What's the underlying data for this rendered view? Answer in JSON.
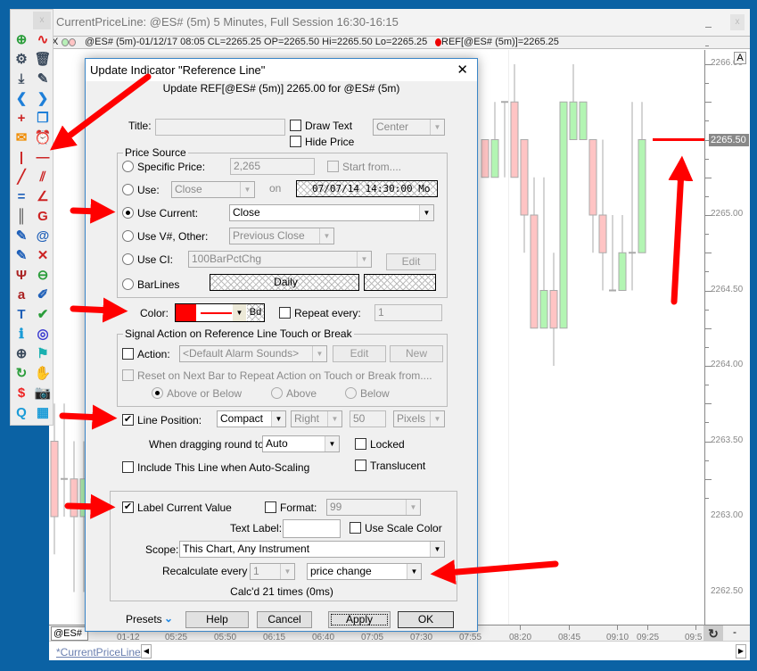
{
  "window": {
    "title": "CurrentPriceLine: @ES# (5m) 5 Minutes, Full Session 16:30-16:15",
    "close_label": "x"
  },
  "infobar": {
    "close": "X",
    "symbol_text": "@ES# (5m)-01/12/17 08:05 CL=2265.25 OP=2265.50 Hi=2265.50 Lo=2265.25",
    "ref_text": "REF[@ES# (5m)]=2265.25"
  },
  "chart": {
    "price_ticks": [
      "2266.00",
      "2265.00",
      "2264.50",
      "2264.00",
      "2263.50",
      "2263.00",
      "2262.50"
    ],
    "current_price_label": "2265.50",
    "reference_line_price": 2265.5,
    "reference_line_color": "#ff0000",
    "up_color": "#b3f5b3",
    "down_color": "#ffc4c4",
    "candles": [
      {
        "o": 2265.5,
        "h": 2265.5,
        "l": 2265.25,
        "c": 2265.25
      },
      {
        "o": 2265.25,
        "h": 2265.75,
        "l": 2265.25,
        "c": 2265.5
      },
      {
        "o": 2265.75,
        "h": 2265.75,
        "l": 2265.25,
        "c": 2265.75
      },
      {
        "o": 2265.75,
        "h": 2266.0,
        "l": 2265.25,
        "c": 2265.25
      },
      {
        "o": 2265.5,
        "h": 2265.5,
        "l": 2264.75,
        "c": 2265.0
      },
      {
        "o": 2265.0,
        "h": 2265.25,
        "l": 2264.25,
        "c": 2264.25
      },
      {
        "o": 2264.25,
        "h": 2265.25,
        "l": 2264.25,
        "c": 2264.5
      },
      {
        "o": 2264.5,
        "h": 2264.75,
        "l": 2264.0,
        "c": 2264.25
      },
      {
        "o": 2264.25,
        "h": 2265.75,
        "l": 2264.25,
        "c": 2265.75
      },
      {
        "o": 2265.5,
        "h": 2266.0,
        "l": 2265.5,
        "c": 2265.75
      },
      {
        "o": 2265.5,
        "h": 2265.75,
        "l": 2265.5,
        "c": 2265.75
      },
      {
        "o": 2265.5,
        "h": 2265.5,
        "l": 2264.75,
        "c": 2265.0
      },
      {
        "o": 2265.0,
        "h": 2265.5,
        "l": 2264.5,
        "c": 2264.75
      },
      {
        "o": 2264.5,
        "h": 2265.0,
        "l": 2264.5,
        "c": 2264.5
      },
      {
        "o": 2264.5,
        "h": 2265.0,
        "l": 2264.5,
        "c": 2264.75
      },
      {
        "o": 2264.75,
        "h": 2265.75,
        "l": 2264.5,
        "c": 2264.75
      },
      {
        "o": 2264.75,
        "h": 2265.75,
        "l": 2264.75,
        "c": 2265.5
      }
    ],
    "left_candles": [
      {
        "o": 2263.5,
        "h": 2263.75,
        "l": 2262.75,
        "c": 2263.0
      },
      {
        "o": 2263.25,
        "h": 2263.75,
        "l": 2263.0,
        "c": 2263.25
      },
      {
        "o": 2263.25,
        "h": 2263.5,
        "l": 2262.5,
        "c": 2263.0
      },
      {
        "o": 2263.0,
        "h": 2263.5,
        "l": 2262.5,
        "c": 2263.25
      }
    ],
    "time_ticks": [
      "01-12",
      "05:25",
      "05:50",
      "06:15",
      "06:40",
      "07:05",
      "07:30",
      "07:55",
      "08:20",
      "08:45",
      "09:10",
      "09:25",
      "09:5"
    ],
    "symbol_box": "@ES#",
    "scale_button": "A"
  },
  "tabs": {
    "active": "*CurrentPriceLine"
  },
  "toolbar": {
    "icons": [
      [
        "add-chart-icon",
        "new-indicator-icon"
      ],
      [
        "gear-icon",
        "trash-icon"
      ],
      [
        "download-icon",
        "pencil-icon"
      ],
      [
        "chevron-left-icon",
        "chevron-right-icon"
      ],
      [
        "crosshair-icon",
        "windows-icon"
      ],
      [
        "note-icon",
        "alarm-clock-icon"
      ],
      [
        "vertical-line-icon",
        "horizontal-line-icon"
      ],
      [
        "trendline-icon",
        "parallel-lines-icon"
      ],
      [
        "double-line-icon",
        "fan-lines-icon"
      ],
      [
        "cycle-lines-icon",
        "gann-fan-icon"
      ],
      [
        "regression-icon",
        "spiral-icon"
      ],
      [
        "regression-channel-icon",
        "arc-icon"
      ],
      [
        "pitchfork-icon",
        "stop-order-icon"
      ],
      [
        "text-icon",
        "highlighter-icon"
      ],
      [
        "title-icon",
        "check-label-icon"
      ],
      [
        "info-icon",
        "shapes-icon"
      ],
      [
        "zoom-icon",
        "flag-icon"
      ],
      [
        "refresh-icon",
        "hand-icon"
      ],
      [
        "price-alert-icon",
        "camera-icon"
      ],
      [
        "quote-icon",
        "grid-icon"
      ]
    ]
  },
  "dialog": {
    "title": "Update Indicator \"Reference Line\"",
    "close": "✕",
    "subtitle": "Update REF[@ES# (5m)] 2265.00 for @ES# (5m)",
    "title_label": "Title:",
    "title_value": "",
    "draw_text": "Draw Text",
    "hide_price": "Hide Price",
    "text_align": "Center",
    "price_source": {
      "label": "Price Source",
      "specific_price": "Specific Price:",
      "specific_price_value": "2,265",
      "start_from": "Start from....",
      "use": "Use:",
      "use_value": "Close",
      "on": "on",
      "on_date": "07/07/14 14:30:00 Mo",
      "use_current": "Use Current:",
      "use_current_value": "Close",
      "use_v": "Use V#, Other:",
      "use_v_value": "Previous Close",
      "use_ci": "Use CI:",
      "use_ci_value": "100BarPctChg",
      "edit": "Edit",
      "barlines": "BarLines",
      "barlines_value": "Daily",
      "selected": "Use Current"
    },
    "color_label": "Color:",
    "color_value": "#ff0000",
    "bd": "Bd",
    "repeat_every": "Repeat every:",
    "repeat_value": "1",
    "signal": {
      "label": "Signal Action on Reference Line Touch or Break",
      "action": "Action:",
      "action_value": "<Default Alarm Sounds>",
      "edit": "Edit",
      "new": "New",
      "reset": "Reset on Next Bar to Repeat Action on Touch or Break from....",
      "above_or_below": "Above or Below",
      "above": "Above",
      "below": "Below"
    },
    "line_position": "Line Position:",
    "line_position_checked": true,
    "position_value": "Compact",
    "side_value": "Right",
    "offset_value": "50",
    "unit_value": "Pixels",
    "dragging_label": "When dragging round to:",
    "dragging_value": "Auto",
    "locked": "Locked",
    "include_autoscale": "Include This Line when Auto-Scaling",
    "translucent": "Translucent",
    "label_current_value": "Label Current Value",
    "label_current_checked": true,
    "format": "Format:",
    "format_value": "99",
    "text_label": "Text Label:",
    "text_label_value": "",
    "use_scale_color": "Use Scale Color",
    "scope_label": "Scope:",
    "scope_value": "This Chart, Any Instrument",
    "recalc_label": "Recalculate every",
    "recalc_n": "1",
    "recalc_unit": "price change",
    "calc_status": "Calc'd 21 times (0ms)",
    "presets": "Presets",
    "help": "Help",
    "cancel": "Cancel",
    "apply": "Apply",
    "ok": "OK"
  }
}
